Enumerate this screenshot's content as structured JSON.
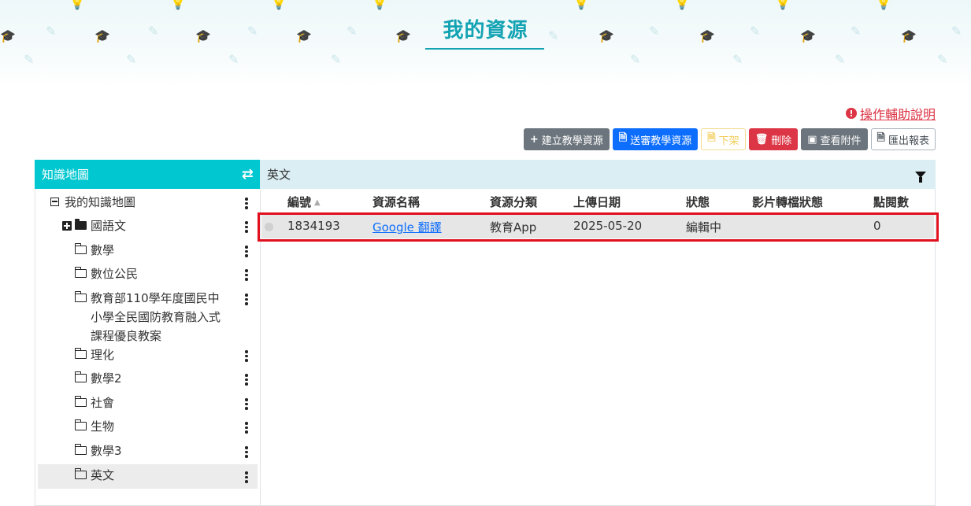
{
  "page": {
    "title": "我的資源"
  },
  "help": {
    "icon": "info-circle-icon",
    "label": "操作輔助說明"
  },
  "toolbar": {
    "create_label": "建立教學資源",
    "submit_label": "送審教學資源",
    "unpublish_label": "下架",
    "delete_label": "刪除",
    "attachments_label": "查看附件",
    "export_label": "匯出報表"
  },
  "tree": {
    "header": "知識地圖",
    "swap_icon": "⇄",
    "root": "我的知識地圖",
    "items": [
      {
        "label": "國語文"
      },
      {
        "label": "數學"
      },
      {
        "label": "數位公民"
      },
      {
        "label": "教育部110學年度國民中小學全民國防教育融入式課程優良教案"
      },
      {
        "label": "理化"
      },
      {
        "label": "數學2"
      },
      {
        "label": "社會"
      },
      {
        "label": "生物"
      },
      {
        "label": "數學3"
      },
      {
        "label": "英文"
      }
    ]
  },
  "table": {
    "category_title": "英文",
    "columns": [
      "編號",
      "資源名稱",
      "資源分類",
      "上傳日期",
      "狀態",
      "影片轉檔狀態",
      "點閱數"
    ],
    "rows": [
      {
        "id": "1834193",
        "name": "Google 翻譯",
        "category": "教育App",
        "date": "2025-05-20",
        "status": "編輯中",
        "video_status": "",
        "views": "0"
      }
    ]
  },
  "colors": {
    "accent": "#00c7d0",
    "title": "#13a3b3",
    "highlight": "#e1101f"
  }
}
